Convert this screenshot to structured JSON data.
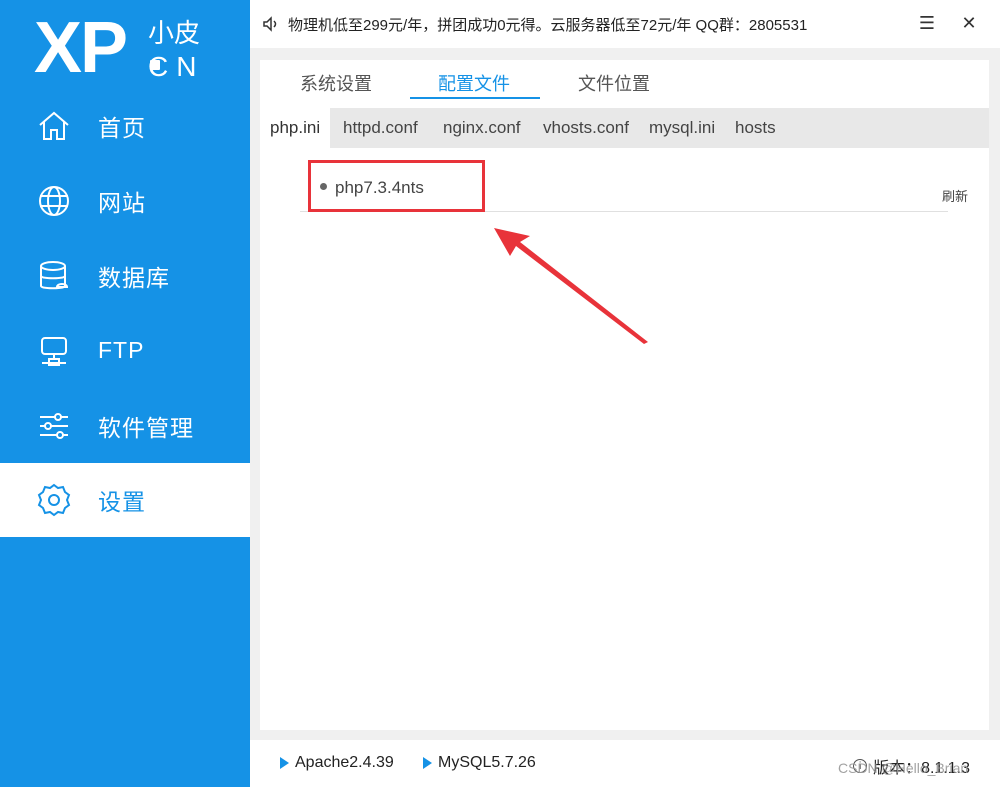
{
  "logo": {
    "xp": "XP",
    "small": "小皮",
    "cn": "CN"
  },
  "sidebar": {
    "items": [
      {
        "label": "首页",
        "icon": "home-icon"
      },
      {
        "label": "网站",
        "icon": "globe-icon"
      },
      {
        "label": "数据库",
        "icon": "database-icon"
      },
      {
        "label": "FTP",
        "icon": "server-icon"
      },
      {
        "label": "软件管理",
        "icon": "sliders-icon"
      },
      {
        "label": "设置",
        "icon": "gear-icon",
        "active": true
      }
    ]
  },
  "topbar": {
    "notice": "物理机低至299元/年，拼团成功0元得。云服务器低至72元/年 QQ群：2805531",
    "menu_glyph": "☰",
    "close_glyph": "✕"
  },
  "tabs": [
    {
      "label": "系统设置"
    },
    {
      "label": "配置文件",
      "active": true
    },
    {
      "label": "文件位置"
    }
  ],
  "subtabs": [
    {
      "label": "php.ini",
      "active": true
    },
    {
      "label": "httpd.conf"
    },
    {
      "label": "nginx.conf"
    },
    {
      "label": "vhosts.conf"
    },
    {
      "label": "mysql.ini"
    },
    {
      "label": "hosts"
    }
  ],
  "config_list": {
    "items": [
      {
        "label": "php7.3.4nts"
      }
    ],
    "refresh_label": "刷新"
  },
  "bottombar": {
    "apache": "Apache2.4.39",
    "mysql": "MySQL5.7.26",
    "version_label": "版本：8.1.1.3"
  },
  "watermark": "CSDN @Hello_Brian",
  "colors": {
    "accent": "#1592e6",
    "annotation": "#e8333a"
  }
}
